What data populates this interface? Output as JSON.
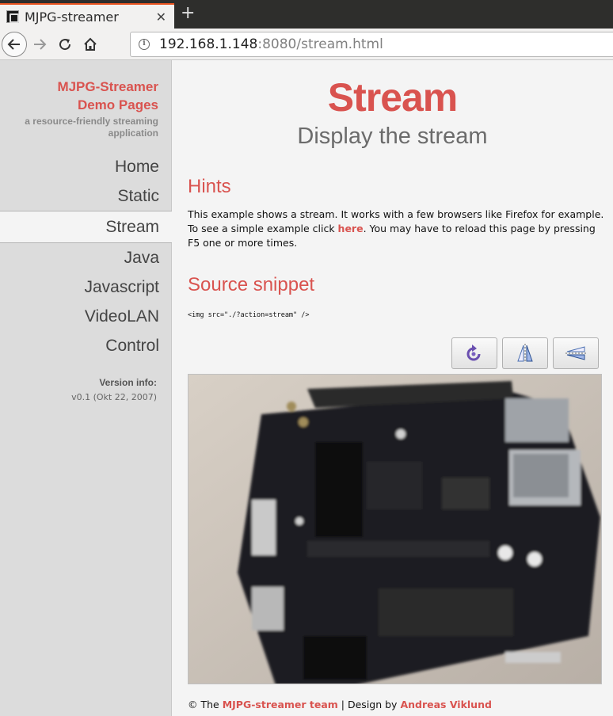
{
  "browser": {
    "tab_title": "MJPG-streamer",
    "url_host": "192.168.1.148",
    "url_rest": ":8080/stream.html"
  },
  "sidebar": {
    "brand_title_1": "MJPG-Streamer",
    "brand_title_2": "Demo Pages",
    "brand_sub_1": "a resource-friendly streaming",
    "brand_sub_2": "application",
    "menu": [
      {
        "label": "Home"
      },
      {
        "label": "Static"
      },
      {
        "label": "Stream"
      },
      {
        "label": "Java"
      },
      {
        "label": "Javascript"
      },
      {
        "label": "VideoLAN"
      },
      {
        "label": "Control"
      }
    ],
    "version_label": "Version info:",
    "version_value": "v0.1 (Okt 22, 2007)"
  },
  "main": {
    "title": "Stream",
    "subtitle": "Display the stream",
    "hints_heading": "Hints",
    "hints_text_1": "This example shows a stream. It works with a few browsers like Firefox for example. To see a simple example click ",
    "hints_link": "here",
    "hints_text_2": ". You may have to reload this page by pressing F5 one or more times.",
    "snippet_heading": "Source snippet",
    "snippet_code": "<img src=\"./?action=stream\" />"
  },
  "footer": {
    "prefix": "© The ",
    "team_link": "MJPG-streamer team",
    "middle": " | Design by ",
    "designer_link": "Andreas Viklund"
  },
  "colors": {
    "accent": "#d9534f",
    "sidebar_bg": "#dcdcdc",
    "content_bg": "#f4f4f4"
  }
}
